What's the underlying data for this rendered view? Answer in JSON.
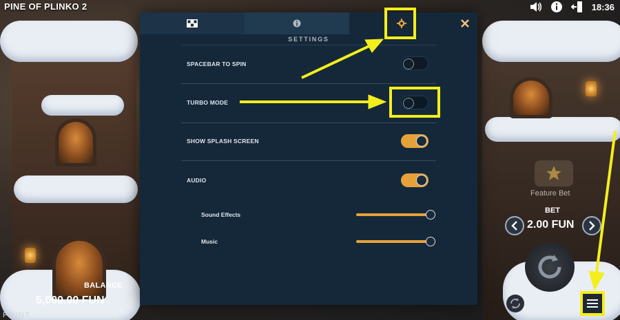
{
  "game": {
    "title": "PINE OF PLINKO 2"
  },
  "status_bar": {
    "time": "18:36",
    "icons": [
      "volume-icon",
      "info-icon",
      "exit-icon"
    ]
  },
  "balance": {
    "label": "BALANCE",
    "value": "5,000.00 FUN"
  },
  "footer": {
    "print": "PRINT"
  },
  "controls": {
    "feature_bet": "Feature Bet",
    "bet_label": "BET",
    "bet_value": "2.00 FUN",
    "icons": [
      "star-icon",
      "chevron-left-icon",
      "chevron-right-icon",
      "spin-icon",
      "autoplay-icon",
      "menu-icon"
    ]
  },
  "settings": {
    "tabs": [
      {
        "icon": "paytable-icon"
      },
      {
        "icon": "info-icon"
      },
      {
        "icon": "gear-icon",
        "active": true
      }
    ],
    "heading": "SETTINGS",
    "options": [
      {
        "label": "SPACEBAR TO SPIN",
        "enabled": false
      },
      {
        "label": "TURBO MODE",
        "enabled": false
      },
      {
        "label": "SHOW SPLASH SCREEN",
        "enabled": true
      },
      {
        "label": "AUDIO",
        "enabled": true
      }
    ],
    "audio": [
      {
        "label": "Sound Effects",
        "level": 1.0
      },
      {
        "label": "Music",
        "level": 1.0
      }
    ]
  },
  "colors": {
    "accent": "#e6a23a",
    "panel": "#15283a",
    "highlight": "#f4ee1c"
  }
}
